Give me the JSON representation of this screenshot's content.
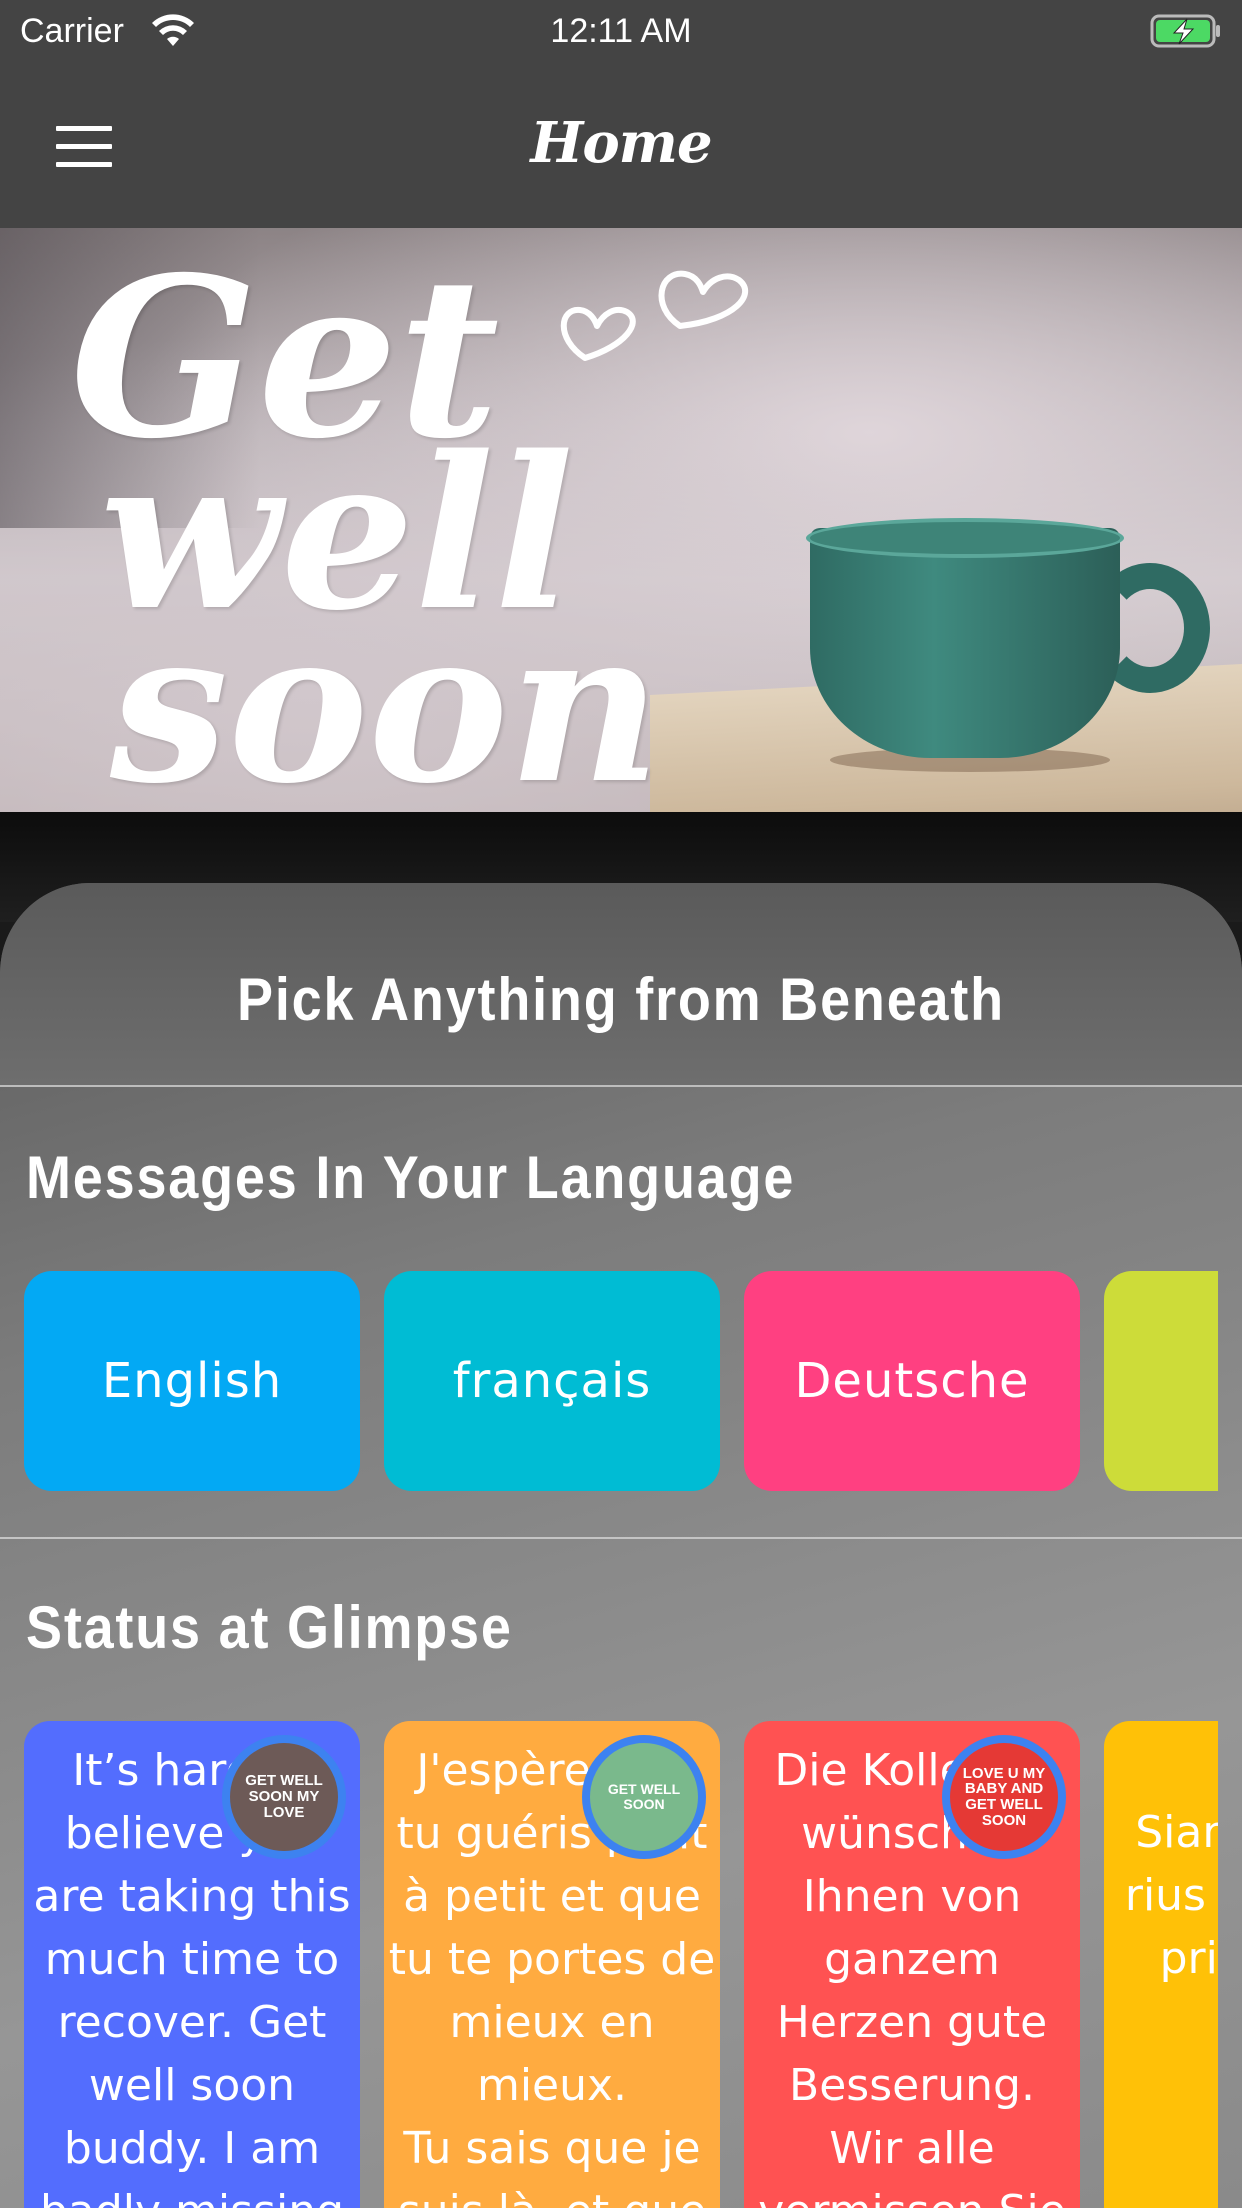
{
  "status_bar": {
    "carrier": "Carrier",
    "time": "12:11 AM",
    "wifi_icon": "wifi-icon",
    "battery_icon": "battery-charging-icon"
  },
  "nav": {
    "title": "Home",
    "menu_icon": "hamburger-menu-icon"
  },
  "hero": {
    "line1": "Get",
    "line2": "well",
    "line3": "soon"
  },
  "panel": {
    "heading": "Pick Anything from Beneath",
    "languages_title": "Messages In Your Language",
    "status_title": "Status at Glimpse"
  },
  "languages": [
    {
      "label": "English",
      "color": "#03a9f4"
    },
    {
      "label": "français",
      "color": "#00bcd4"
    },
    {
      "label": "Deutsche",
      "color": "#ff4081"
    },
    {
      "label": "",
      "color": "#cddc39"
    }
  ],
  "statuses": [
    {
      "text": "It’s hard to believe you are taking this much time to recover. Get well soon buddy. I am badly missing",
      "color": "#536dfe",
      "avatar_text": "GET WELL SOON MY LOVE",
      "avatar_bg": "#6d5a57"
    },
    {
      "text": "J'espère que tu guéris petit à petit et que tu te portes de mieux en mieux.\nTu sais que je suis là, et que",
      "color": "#ffab40",
      "avatar_text": "GET WELL SOON",
      "avatar_bg": "#7ab98c"
    },
    {
      "text": "Die Kollegen wünschen Ihnen von ganzem Herzen gute Besserung. Wir alle vermissen Sie und",
      "color": "#ff5252",
      "avatar_text": "LOVE U MY BABY AND GET WELL SOON",
      "avatar_bg": "#e53935"
    },
    {
      "text": "Siamo che ti rius esser sto prima qua",
      "color": "#ffc107",
      "avatar_text": "",
      "avatar_bg": ""
    }
  ]
}
